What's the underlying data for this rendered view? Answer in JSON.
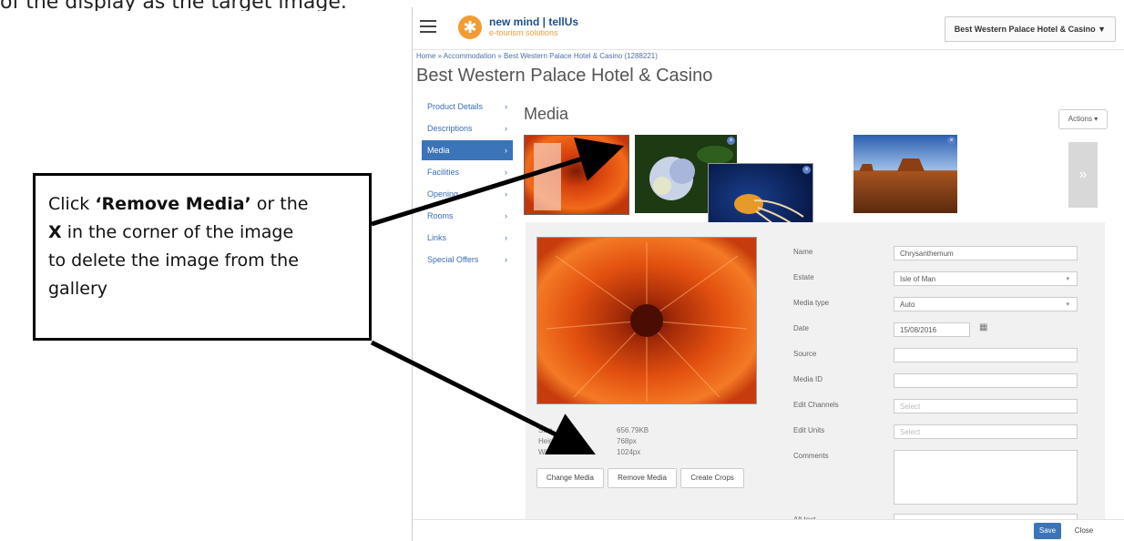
{
  "top_caption": "of the display as the target image.",
  "app": {
    "logo_main": "new mind | tellUs",
    "logo_sub": "e-tourism solutions",
    "hotel_selector": "Best Western Palace Hotel & Casino ▼"
  },
  "breadcrumb": "Home » Accommodation » Best Western Palace Hotel & Casino (1288221)",
  "page_title": "Best Western Palace Hotel & Casino",
  "sidebar": {
    "items": [
      {
        "label": "Product Details",
        "arrow": "›"
      },
      {
        "label": "Descriptions",
        "arrow": "›"
      },
      {
        "label": "Media",
        "arrow": "›"
      },
      {
        "label": "Facilities",
        "arrow": "›"
      },
      {
        "label": "Opening",
        "arrow": "›"
      },
      {
        "label": "Rooms",
        "arrow": "›"
      },
      {
        "label": "Links",
        "arrow": "›"
      },
      {
        "label": "Special Offers",
        "arrow": "›"
      }
    ]
  },
  "media": {
    "heading": "Media",
    "actions_label": "Actions ▾",
    "next_label": "»",
    "details": {
      "size_label": "Size",
      "size_value": "656.79KB",
      "height_label": "Height",
      "height_value": "768px",
      "width_label": "Width",
      "width_value": "1024px"
    },
    "buttons": {
      "change": "Change Media",
      "remove": "Remove Media",
      "crops": "Create Crops"
    },
    "form": {
      "name_label": "Name",
      "name_value": "Chrysanthemum",
      "estate_label": "Estate",
      "estate_value": "Isle of Man",
      "type_label": "Media type",
      "type_value": "Auto",
      "date_label": "Date",
      "date_value": "15/08/2016",
      "source_label": "Source",
      "mediaid_label": "Media ID",
      "channels_label": "Edit Channels",
      "channels_placeholder": "Select",
      "units_label": "Edit Units",
      "units_placeholder": "Select",
      "comments_label": "Comments",
      "alttext_label": "Alt text"
    }
  },
  "footer": {
    "save": "Save",
    "close": "Close"
  },
  "callout": {
    "line1_pre": "Click ",
    "line1_bold": "‘Remove Media’",
    "line1_post": " or the",
    "line2_bold": "X",
    "line2_post": " in the corner of the image",
    "line3": "to delete the image from the",
    "line4": "gallery"
  },
  "icons": {
    "close_thumb": "×",
    "calendar": "▦",
    "dropdown": "▾"
  },
  "colors": {
    "accent": "#3b74b8",
    "logo_orange": "#f39c33"
  }
}
